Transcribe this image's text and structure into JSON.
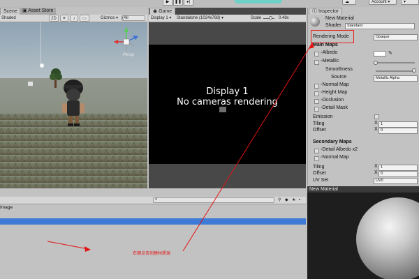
{
  "top_bar": {
    "account_label": "Account",
    "play_icons": [
      "play-icon",
      "pause-icon",
      "step-icon"
    ]
  },
  "scene_panel": {
    "tabs": [
      {
        "label": "Scene"
      },
      {
        "label": "Asset Store"
      }
    ],
    "shading": "Shaded",
    "mode_2d": "2D",
    "gizmos_label": "Gizmos",
    "search_placeholder": "(All",
    "persp_label": "Persp"
  },
  "game_panel": {
    "tab_label": "Game",
    "display": "Display 1",
    "resolution": "Standalone (1024x768)",
    "scale_label": "Scale",
    "scale_value": "0.48x",
    "message_line1": "Display 1",
    "message_line2": "No cameras rendering"
  },
  "project_panel": {
    "column_header": "Image",
    "annotation": "右键点击创建材质球"
  },
  "inspector": {
    "tab_label": "Inspector",
    "material_name": "New Material",
    "shader_label": "Shader",
    "shader_value": "Standard",
    "rendering_mode_label": "Rendering Mode",
    "rendering_mode_value": "Opaque",
    "main_maps_header": "Main Maps",
    "albedo": "Albedo",
    "metallic": "Metallic",
    "smoothness": "Smoothness",
    "source_label": "Source",
    "source_value": "Metallic Alpha",
    "normal_map": "Normal Map",
    "height_map": "Height Map",
    "occlusion": "Occlusion",
    "detail_mask": "Detail Mask",
    "emission": "Emission",
    "tiling": "Tiling",
    "offset": "Offset",
    "x_label": "X",
    "tiling_x": "1",
    "offset_x": "0",
    "secondary_maps_header": "Secondary Maps",
    "detail_albedo": "Detail Albedo x2",
    "sec_normal_map": "Normal Map",
    "sec_tiling_x": "1",
    "sec_offset_x": "0",
    "uv_set_label": "UV Set",
    "uv_set_value": "UV0"
  },
  "preview": {
    "title": "New Material"
  },
  "colors": {
    "highlight_box": "#e8201a",
    "selection_blue": "#3d7bd6",
    "annotation_red": "#e31414"
  }
}
